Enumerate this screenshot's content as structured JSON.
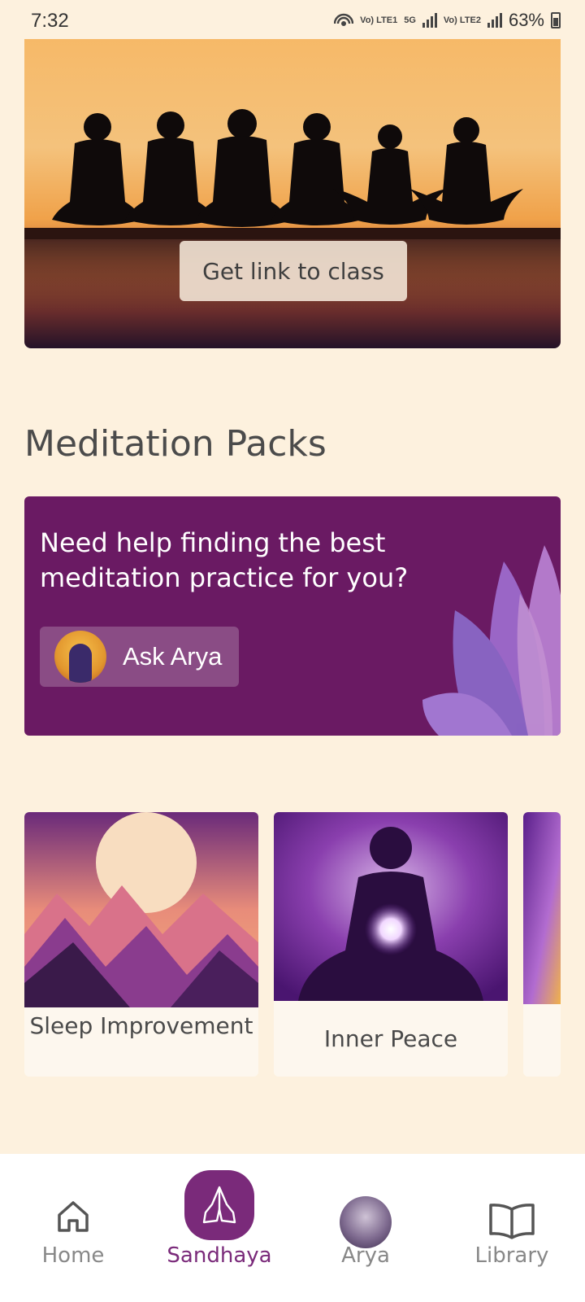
{
  "status": {
    "time": "7:32",
    "battery": "63%",
    "network_labels": [
      "Vo) LTE1",
      "5G",
      "Vo) LTE2"
    ]
  },
  "hero": {
    "button_label": "Get link to class"
  },
  "meditation": {
    "section_title": "Meditation Packs",
    "promo_text": "Need help finding the best meditation practice for you?",
    "ask_label": "Ask Arya",
    "packs": [
      {
        "label": "Sleep Improvement"
      },
      {
        "label": "Inner Peace"
      }
    ]
  },
  "nav": {
    "items": [
      {
        "label": "Home",
        "icon": "home-icon"
      },
      {
        "label": "Sandhaya",
        "icon": "praying-hands-icon",
        "active": true
      },
      {
        "label": "Arya",
        "icon": "avatar"
      },
      {
        "label": "Library",
        "icon": "book-icon"
      }
    ]
  },
  "colors": {
    "background": "#fdf1de",
    "accent": "#7a2a7a",
    "promo": "#6a1a63"
  }
}
